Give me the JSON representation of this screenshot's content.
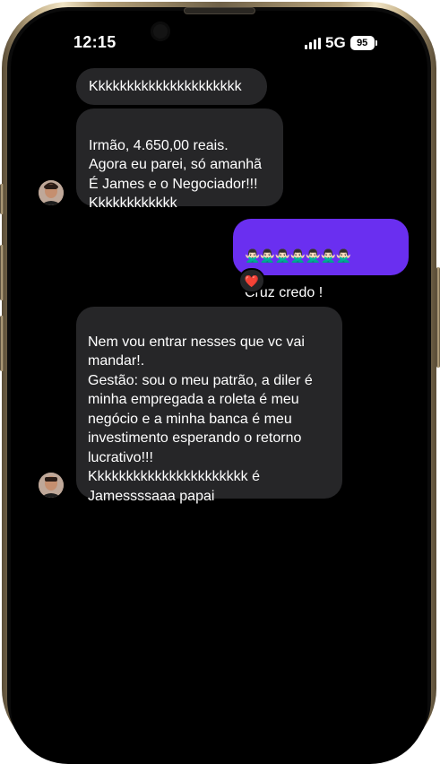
{
  "status_bar": {
    "time": "12:15",
    "network": "5G",
    "battery": "95"
  },
  "messages": [
    {
      "sender": "other",
      "text": "Kkkkkkkkkkkkkkkkkkkkk"
    },
    {
      "sender": "other",
      "text": "Irmão, 4.650,00 reais.\nAgora eu parei, só amanhã\nÉ James e o Negociador!!!\nKkkkkkkkkkkk"
    },
    {
      "sender": "me",
      "emoji_line": "🙅🏻‍♂️🙅🏻‍♂️🙅🏻‍♂️🙅🏻‍♂️🙅🏻‍♂️🙅🏻‍♂️🙅🏻‍♂️",
      "text": "Cruz credo !",
      "reaction": "❤️"
    },
    {
      "sender": "other",
      "text": "Nem vou entrar nesses que vc vai\nmandar!.\nGestão: sou o meu patrão, a diler é\nminha empregada a roleta é meu\nnegócio e a minha banca é meu\ninvestimento esperando o retorno\nlucrativo!!!\nKkkkkkkkkkkkkkkkkkkkkk é\nJamessssaaa papai"
    }
  ]
}
